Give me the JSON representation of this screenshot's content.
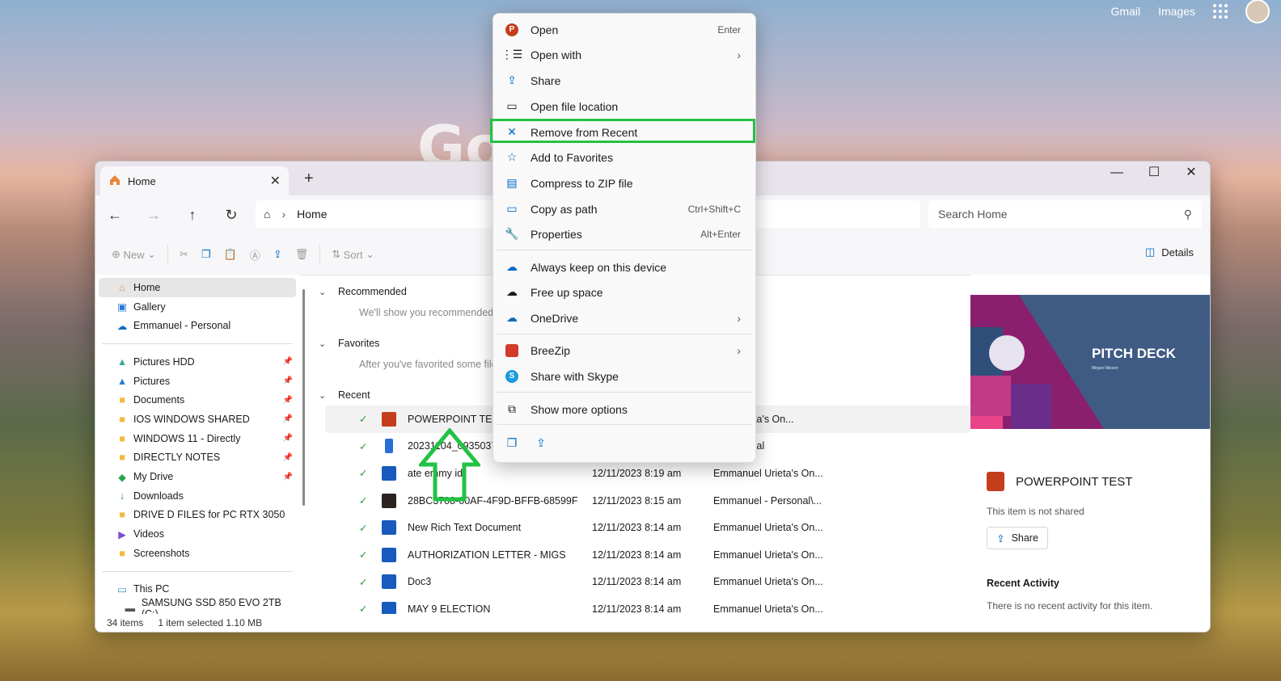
{
  "browser": {
    "links": [
      "Gmail",
      "Images"
    ],
    "logo_text": "Go"
  },
  "window": {
    "tab_title": "Home",
    "breadcrumb": "Home",
    "search_placeholder": "Search Home",
    "toolbar": {
      "new": "New",
      "sort": "Sort",
      "details": "Details"
    }
  },
  "sidebar": {
    "items": [
      {
        "label": "Home",
        "icon": "home-icon",
        "selected": true
      },
      {
        "label": "Gallery",
        "icon": "gallery-icon"
      },
      {
        "label": "Emmanuel - Personal",
        "icon": "onedrive-icon"
      }
    ],
    "quick": [
      {
        "label": "Pictures HDD",
        "icon": "pictures-icon",
        "pinned": true
      },
      {
        "label": "Pictures",
        "icon": "pictures-icon",
        "pinned": true
      },
      {
        "label": "Documents",
        "icon": "folder-icon",
        "pinned": true
      },
      {
        "label": "IOS WINDOWS SHARED",
        "icon": "folder-icon",
        "pinned": true
      },
      {
        "label": "WINDOWS 11 - Directly",
        "icon": "folder-icon",
        "pinned": true
      },
      {
        "label": "DIRECTLY NOTES",
        "icon": "folder-icon",
        "pinned": true
      },
      {
        "label": "My Drive",
        "icon": "drive-icon",
        "pinned": true
      },
      {
        "label": "Downloads",
        "icon": "download-icon"
      },
      {
        "label": "DRIVE D FILES for PC RTX 3050",
        "icon": "folder-icon"
      },
      {
        "label": "Videos",
        "icon": "videos-icon"
      },
      {
        "label": "Screenshots",
        "icon": "folder-icon"
      }
    ],
    "pc": [
      {
        "label": "This PC",
        "icon": "pc-icon"
      },
      {
        "label": "SAMSUNG SSD 850 EVO 2TB (C:)",
        "icon": "drive-icon"
      }
    ]
  },
  "main": {
    "recommended": "Recommended",
    "recommended_hint": "We'll show you recommended f",
    "favorites": "Favorites",
    "favorites_hint": "After you've favorited some file",
    "recent": "Recent",
    "rows": [
      {
        "name": "POWERPOINT TEST",
        "date": "",
        "location": "nuel Urieta's On...",
        "type": "ppt",
        "selected": true
      },
      {
        "name": "20231104_09350378",
        "date": "",
        "location": "l - Personal",
        "type": "phone"
      },
      {
        "name": "ate emmy id",
        "date": "12/11/2023 8:19 am",
        "location": "Emmanuel Urieta's On...",
        "type": "word"
      },
      {
        "name": "28BC3708-00AF-4F9D-BFFB-68599F...",
        "date": "12/11/2023 8:15 am",
        "location": "Emmanuel - Personal\\...",
        "type": "image"
      },
      {
        "name": "New Rich Text Document",
        "date": "12/11/2023 8:14 am",
        "location": "Emmanuel Urieta's On...",
        "type": "word"
      },
      {
        "name": "AUTHORIZATION LETTER - MIGS",
        "date": "12/11/2023 8:14 am",
        "location": "Emmanuel Urieta's On...",
        "type": "word"
      },
      {
        "name": "Doc3",
        "date": "12/11/2023 8:14 am",
        "location": "Emmanuel Urieta's On...",
        "type": "word"
      },
      {
        "name": "MAY 9 ELECTION",
        "date": "12/11/2023 8:14 am",
        "location": "Emmanuel Urieta's On...",
        "type": "word"
      }
    ]
  },
  "details": {
    "thumb_title": "PITCH DECK",
    "thumb_sub": "Mirjam Nilsson",
    "file_name": "POWERPOINT TEST",
    "not_shared": "This item is not shared",
    "share": "Share",
    "recent_activity": "Recent Activity",
    "no_activity": "There is no recent activity for this item."
  },
  "status": {
    "count": "34 items",
    "selected": "1 item selected  1.10 MB"
  },
  "context_menu": {
    "open": "Open",
    "open_sc": "Enter",
    "open_with": "Open with",
    "share": "Share",
    "open_location": "Open file location",
    "remove_recent": "Remove from Recent",
    "add_favorites": "Add to Favorites",
    "compress": "Compress to ZIP file",
    "copy_path": "Copy as path",
    "copy_path_sc": "Ctrl+Shift+C",
    "properties": "Properties",
    "properties_sc": "Alt+Enter",
    "keep": "Always keep on this device",
    "free": "Free up space",
    "onedrive": "OneDrive",
    "breezip": "BreeZip",
    "skype": "Share with Skype",
    "more": "Show more options"
  },
  "colors": {
    "highlight": "#22c244",
    "accent": "#0067c0",
    "ppt": "#c43e1c",
    "word": "#185abd"
  }
}
